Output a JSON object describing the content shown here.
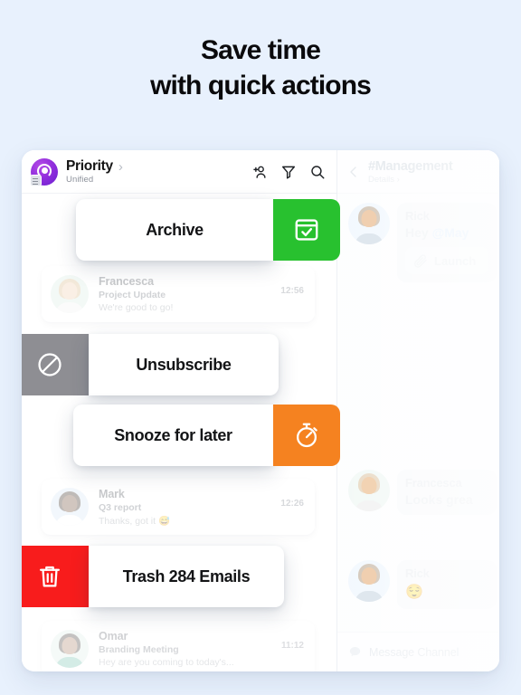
{
  "headline": {
    "line1": "Save time",
    "line2": "with quick actions"
  },
  "colors": {
    "background": "#e8f1fd",
    "archive_green": "#28c12f",
    "snooze_orange": "#f58220",
    "unsubscribe_gray": "#8e8e93",
    "trash_red": "#f81c1c",
    "brand_purple": "#9330dd"
  },
  "app": {
    "left_header": {
      "logo_icon": "priority-logo-icon",
      "title": "Priority",
      "title_chevron": "›",
      "subtitle": "Unified",
      "icons": [
        {
          "name": "add-person-icon",
          "label": "Add person"
        },
        {
          "name": "filter-icon",
          "label": "Filter"
        },
        {
          "name": "search-icon",
          "label": "Search"
        }
      ]
    },
    "right_header": {
      "back_icon": "chevron-left-icon",
      "title": "#Management",
      "subtitle": "Details",
      "subtitle_chevron": "›"
    },
    "mail_rows": [
      {
        "avatar": "avatar-francesca",
        "name": "Francesca",
        "subject": "Project Update",
        "preview": "We're good to go!",
        "time": "12:56"
      },
      {
        "avatar": "avatar-mark",
        "name": "Mark",
        "subject": "Q3 report",
        "preview": "Thanks, got it 😅",
        "time": "12:26"
      },
      {
        "avatar": "avatar-omar",
        "name": "Omar",
        "subject": "Branding Meeting",
        "preview": "Hey are you coming to today's...",
        "time": "11:12"
      }
    ],
    "actions": [
      {
        "label": "Archive",
        "icon": "archive-box-check-icon",
        "tile_color": "#28c12f",
        "tile_side": "right"
      },
      {
        "label": "Unsubscribe",
        "icon": "prohibition-icon",
        "tile_color": "#8e8e93",
        "tile_side": "left"
      },
      {
        "label": "Snooze for later",
        "icon": "stopwatch-icon",
        "tile_color": "#f58220",
        "tile_side": "right"
      },
      {
        "label": "Trash 284 Emails",
        "icon": "trash-can-icon",
        "tile_color": "#f81c1c",
        "tile_side": "left"
      }
    ],
    "chat": {
      "messages": [
        {
          "avatar": "avatar-rick",
          "name": "Rick",
          "text": "Hey ",
          "mention": "@May",
          "attachment_icon": "paperclip-icon",
          "attachment_name": "Launch"
        },
        {
          "avatar": "avatar-francesca",
          "name": "Francesca",
          "text": "Looks grea"
        },
        {
          "avatar": "avatar-rick",
          "name": "Rick",
          "emoji": "😌"
        }
      ],
      "composer": {
        "icon": "chat-bubble-icon",
        "placeholder": "Message Channel"
      }
    }
  }
}
